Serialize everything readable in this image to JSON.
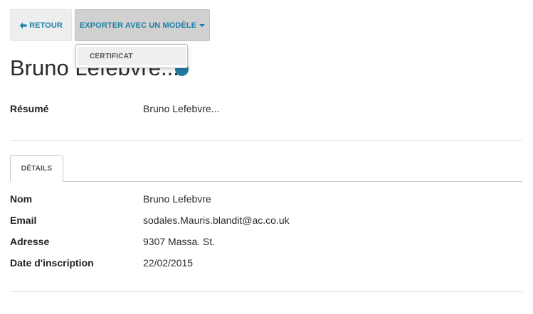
{
  "toolbar": {
    "back_label": "RETOUR",
    "export_label": "EXPORTER AVEC UN MODÈLE",
    "export_menu": {
      "items": [
        {
          "label": "CERTIFICAT"
        }
      ]
    }
  },
  "record": {
    "title": "Bruno Lefebvre...",
    "summary_label": "Résumé",
    "summary_value": "Bruno Lefebvre..."
  },
  "tabs": [
    {
      "label": "DÉTAILS",
      "active": true
    }
  ],
  "details": {
    "fields": [
      {
        "label": "Nom",
        "value": "Bruno Lefebvre"
      },
      {
        "label": "Email",
        "value": "sodales.Mauris.blandit@ac.co.uk"
      },
      {
        "label": "Adresse",
        "value": "9307 Massa. St."
      },
      {
        "label": "Date d'inscription",
        "value": "22/02/2015"
      }
    ]
  },
  "colors": {
    "accent": "#1c7fa6",
    "status_dot": "#1d7ba4"
  },
  "icons": {
    "back": "arrow-left-icon",
    "export_caret": "caret-down-icon",
    "status": "status-dot-icon"
  }
}
